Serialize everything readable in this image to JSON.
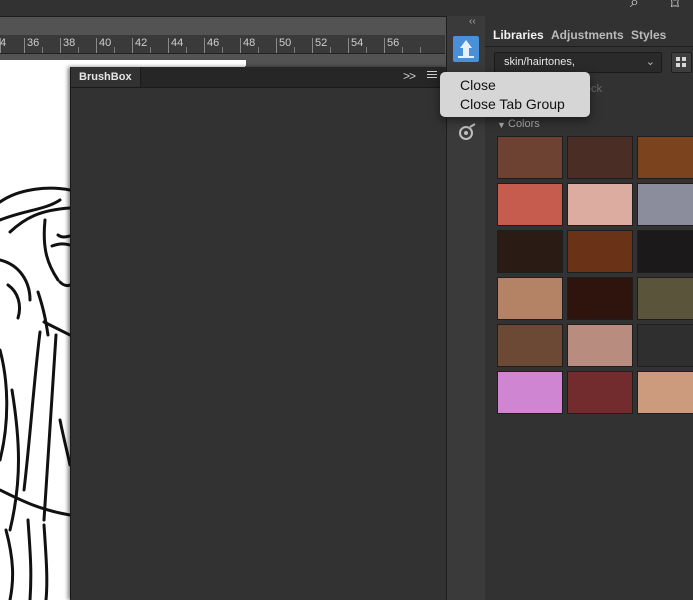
{
  "ruler": {
    "labels": [
      "4",
      "36",
      "38",
      "40",
      "42",
      "44",
      "46",
      "48",
      "50",
      "52",
      "54",
      "56"
    ]
  },
  "brushbox": {
    "tab_label": "BrushBox",
    "collapse_label": ">>"
  },
  "dock": {
    "collapse_label": "‹‹"
  },
  "libraries_panel": {
    "tabs": [
      "Libraries",
      "Adjustments",
      "Styles"
    ],
    "library_select_value": "skin/hairtones,",
    "lock_text": "ock",
    "colors_section_label": "Colors",
    "swatches": [
      "#6e4232",
      "#4a2d25",
      "#7c431f",
      "#c55c4d",
      "#ddaca0",
      "#8c8d9c",
      "#2a1b15",
      "#6a3318",
      "#1b1919",
      "#b48366",
      "#2e140c",
      "#59543a",
      "#6c4935",
      "#b88d80",
      "#2f2f2f",
      "#cf85d2",
      "#732c2d",
      "#cc9a7d"
    ]
  },
  "context_menu": {
    "items": [
      "Close",
      "Close Tab Group"
    ]
  }
}
